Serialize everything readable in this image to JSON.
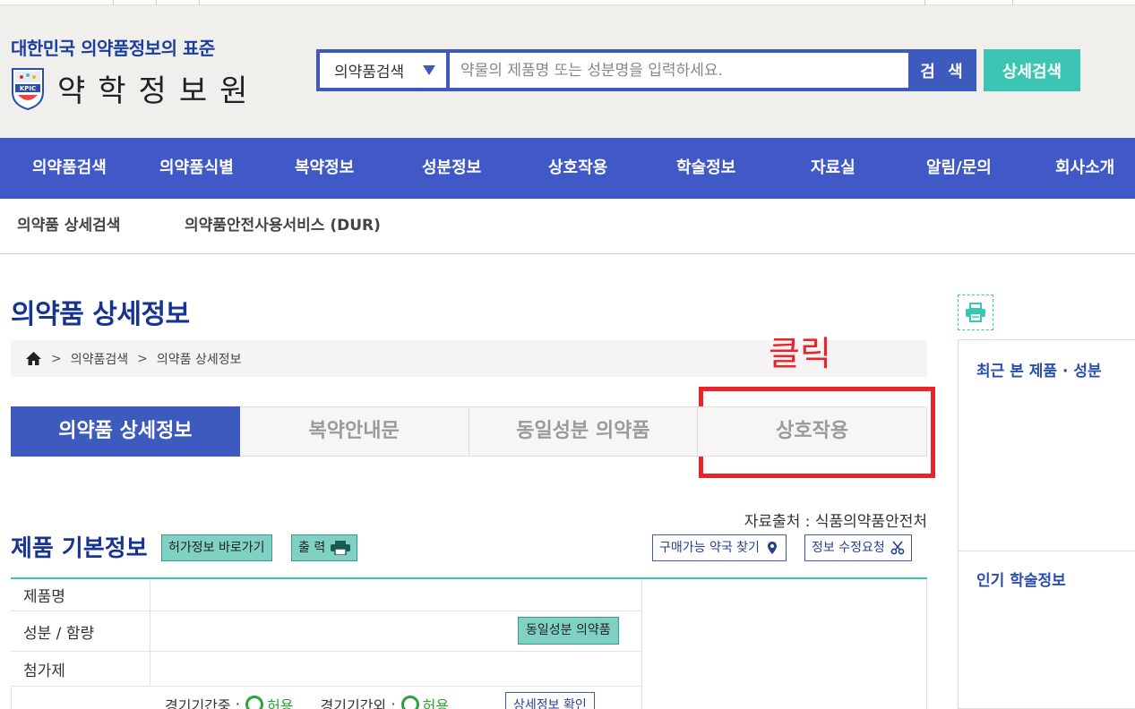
{
  "header": {
    "slogan": "대한민국 의약품정보의 표준",
    "logo_text": "약학정보원",
    "logo_badge": "KPIC",
    "search": {
      "category": "의약품검색",
      "placeholder": "약물의 제품명 또는 성분명을 입력하세요.",
      "value": ""
    },
    "search_button": "검 색",
    "advanced_search_button": "상세검색"
  },
  "main_nav": [
    "의약품검색",
    "의약품식별",
    "복약정보",
    "성분정보",
    "상호작용",
    "학술정보",
    "자료실",
    "알림/문의",
    "회사소개"
  ],
  "sub_nav": [
    "의약품 상세검색",
    "의약품안전사용서비스 (DUR)"
  ],
  "page": {
    "title": "의약품 상세정보",
    "breadcrumb": [
      "의약품검색",
      "의약품 상세정보"
    ]
  },
  "annotation": {
    "text": "클릭",
    "color": "#e8252b"
  },
  "tabs": [
    {
      "label": "의약품 상세정보",
      "active": true
    },
    {
      "label": "복약안내문",
      "active": false
    },
    {
      "label": "동일성분 의약품",
      "active": false
    },
    {
      "label": "상호작용",
      "active": false
    }
  ],
  "source_text": "자료출처 : 식품의약품안전처",
  "section": {
    "title": "제품 기본정보",
    "license_button": "허가정보 바로가기",
    "print_button": "출 력",
    "pharmacy_button": "구매가능 약국 찾기",
    "edit_request_button": "정보 수정요청"
  },
  "table": {
    "rows": [
      {
        "label": "제품명"
      },
      {
        "label": "성분 / 함량",
        "button": "동일성분 의약품"
      },
      {
        "label": "첨가제"
      }
    ],
    "pregnancy": {
      "in_period_label": "경기기간중 :",
      "in_period_value": "허용",
      "out_period_label": "경기기간외 :",
      "out_period_value": "허용",
      "detail_button": "상세정보 확인"
    }
  },
  "side": {
    "recent_title": "최근 본 제품 · 성분",
    "popular_title": "인기 학술정보"
  },
  "colors": {
    "brand_blue": "#3d5bbf",
    "nav_blue": "#4159c6",
    "teal": "#3cc5b3",
    "title_navy": "#17348f"
  }
}
